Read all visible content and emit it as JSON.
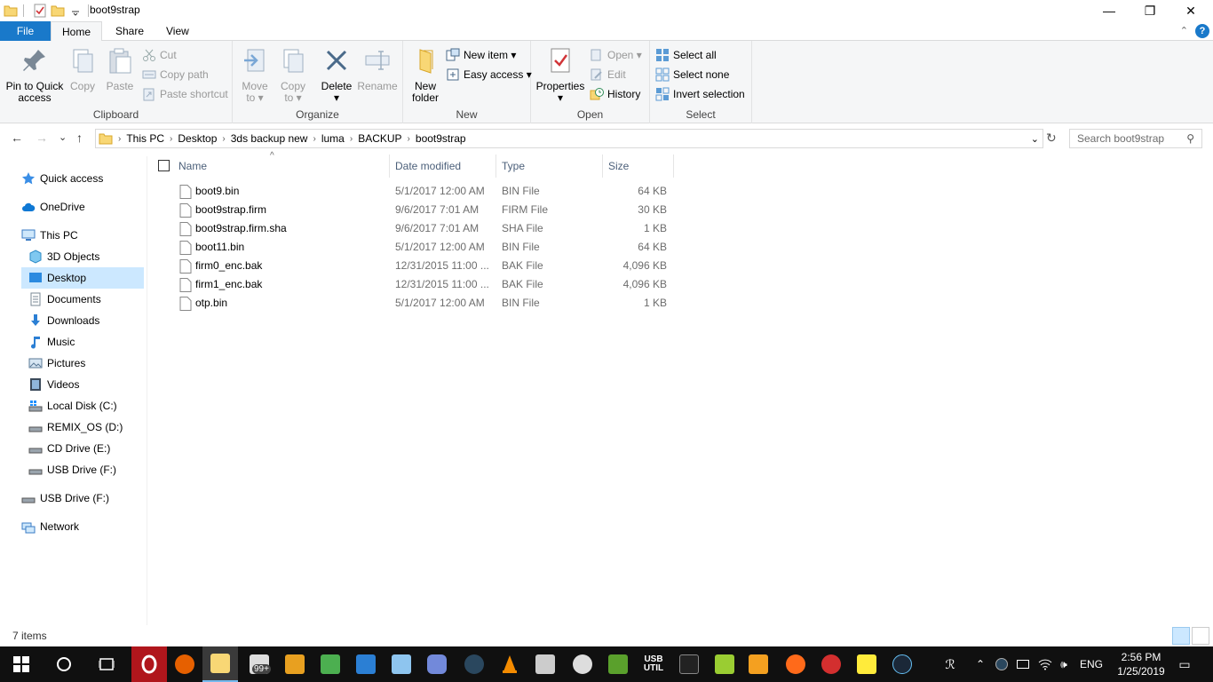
{
  "window": {
    "title": "boot9strap",
    "minimize_glyph": "—",
    "maximize_glyph": "❐",
    "close_glyph": "✕"
  },
  "ribbon_tabs": {
    "file": "File",
    "home": "Home",
    "share": "Share",
    "view": "View",
    "help": "?",
    "collapse": "⌃"
  },
  "ribbon": {
    "clipboard": {
      "label": "Clipboard",
      "pin_line1": "Pin to Quick",
      "pin_line2": "access",
      "copy": "Copy",
      "paste": "Paste",
      "cut": "Cut",
      "copy_path": "Copy path",
      "paste_shortcut": "Paste shortcut"
    },
    "organize": {
      "label": "Organize",
      "move_line1": "Move",
      "move_line2": "to ▾",
      "copy_line1": "Copy",
      "copy_line2": "to ▾",
      "delete_line1": "Delete",
      "delete_line2": "▾",
      "rename": "Rename"
    },
    "new": {
      "label": "New",
      "new_folder_line1": "New",
      "new_folder_line2": "folder",
      "new_item": "New item ▾",
      "easy_access": "Easy access ▾"
    },
    "open": {
      "label": "Open",
      "properties_line1": "Properties",
      "properties_line2": "▾",
      "open": "Open ▾",
      "edit": "Edit",
      "history": "History"
    },
    "select": {
      "label": "Select",
      "select_all": "Select all",
      "select_none": "Select none",
      "invert_selection": "Invert selection"
    }
  },
  "address": {
    "back": "←",
    "forward": "→",
    "recent": "⌄",
    "up": "↑",
    "breadcrumbs": [
      "This PC",
      "Desktop",
      "3ds backup new",
      "luma",
      "BACKUP",
      "boot9strap"
    ],
    "separator": "›",
    "dropdown": "⌄",
    "refresh": "↻"
  },
  "search": {
    "placeholder": "Search boot9strap",
    "icon": "⚲"
  },
  "nav_pane": {
    "quick_access": "Quick access",
    "onedrive": "OneDrive",
    "this_pc": "This PC",
    "objects_3d": "3D Objects",
    "desktop": "Desktop",
    "documents": "Documents",
    "downloads": "Downloads",
    "music": "Music",
    "pictures": "Pictures",
    "videos": "Videos",
    "local_disk": "Local Disk (C:)",
    "remix_os": "REMIX_OS (D:)",
    "cd_drive": "CD Drive (E:)",
    "usb_drive_sub": "USB Drive (F:)",
    "usb_drive": "USB Drive (F:)",
    "network": "Network"
  },
  "columns": {
    "name": "Name",
    "date_modified": "Date modified",
    "type": "Type",
    "size": "Size",
    "sort_glyph": "^"
  },
  "files": [
    {
      "name": "boot9.bin",
      "date": "5/1/2017 12:00 AM",
      "type": "BIN File",
      "size": "64 KB"
    },
    {
      "name": "boot9strap.firm",
      "date": "9/6/2017 7:01 AM",
      "type": "FIRM File",
      "size": "30 KB"
    },
    {
      "name": "boot9strap.firm.sha",
      "date": "9/6/2017 7:01 AM",
      "type": "SHA File",
      "size": "1 KB"
    },
    {
      "name": "boot11.bin",
      "date": "5/1/2017 12:00 AM",
      "type": "BIN File",
      "size": "64 KB"
    },
    {
      "name": "firm0_enc.bak",
      "date": "12/31/2015 11:00 ...",
      "type": "BAK File",
      "size": "4,096 KB"
    },
    {
      "name": "firm1_enc.bak",
      "date": "12/31/2015 11:00 ...",
      "type": "BAK File",
      "size": "4,096 KB"
    },
    {
      "name": "otp.bin",
      "date": "5/1/2017 12:00 AM",
      "type": "BIN File",
      "size": "1 KB"
    }
  ],
  "status": {
    "item_count": "7 items"
  },
  "taskbar": {
    "badge": "99+",
    "usb_util_line1": "USB",
    "usb_util_line2": "UTIL",
    "people": "ℛ",
    "chevron": "⌃",
    "volume": "🕪",
    "language": "ENG",
    "time": "2:56 PM",
    "date": "1/25/2019",
    "notification": "▭"
  },
  "colors": {
    "accent": "#1979ca",
    "selection": "#cce8ff",
    "taskbar": "#101010"
  }
}
